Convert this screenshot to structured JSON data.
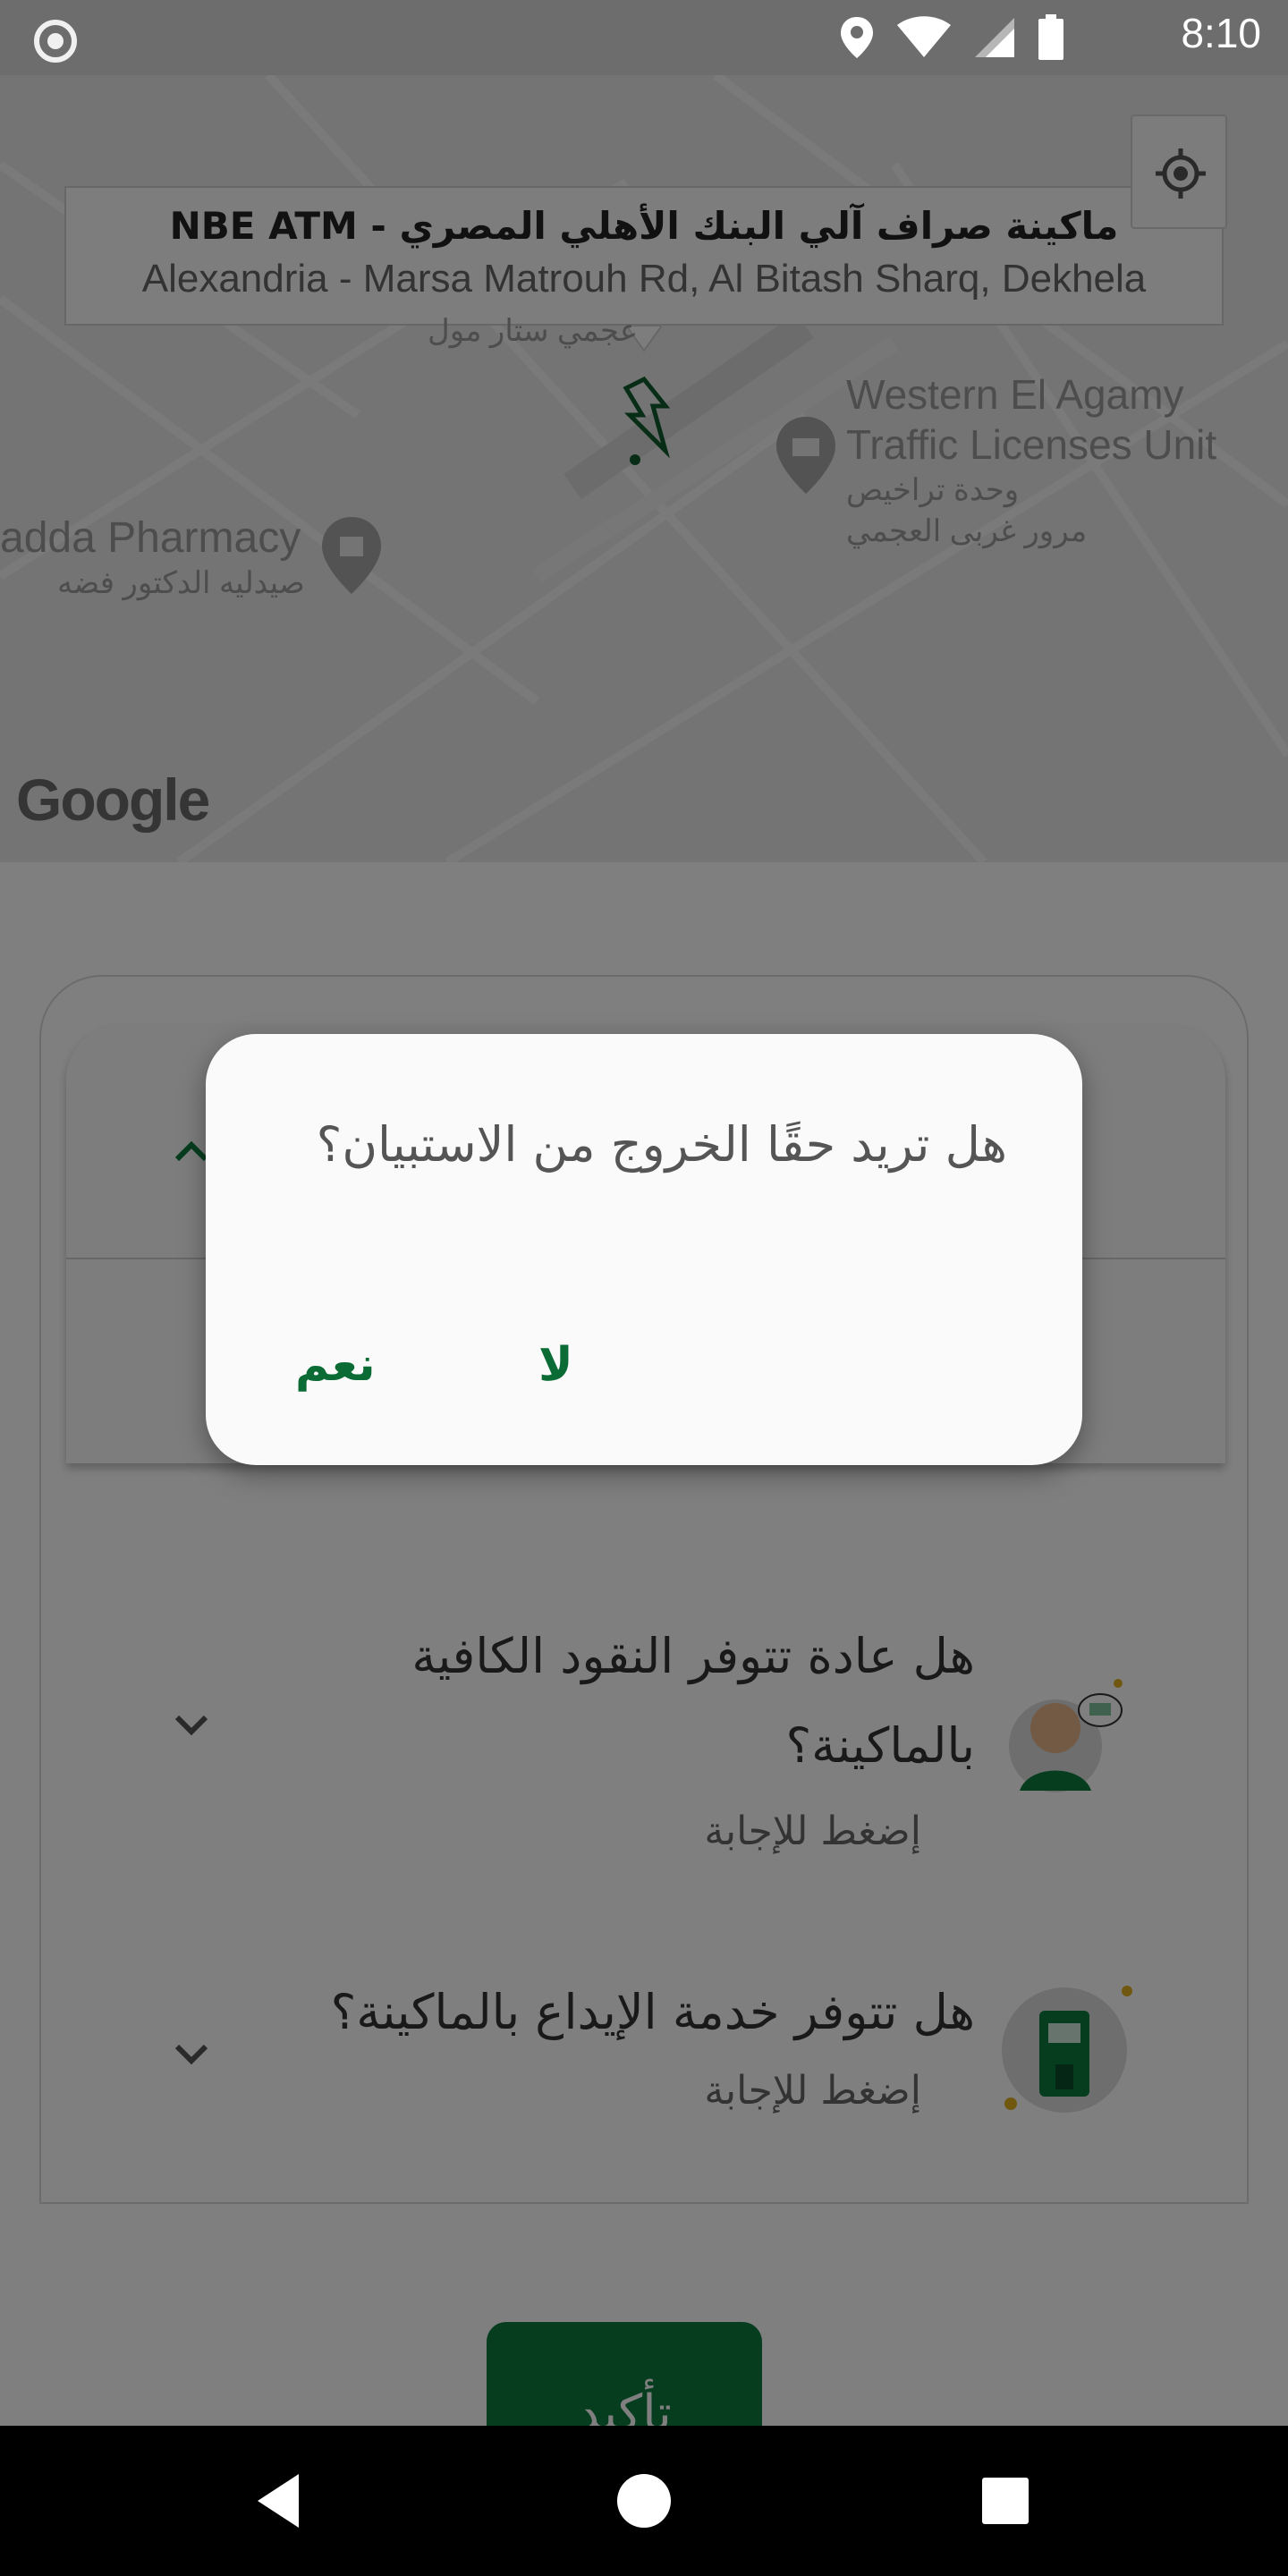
{
  "status_bar": {
    "time": "8:10",
    "icons": [
      "screen-record-icon",
      "location-icon",
      "wifi-icon",
      "signal-icon",
      "battery-icon"
    ]
  },
  "map": {
    "info_window": {
      "title": "ماكينة صراف آلي البنك الأهلي المصري - NBE ATM",
      "address": "Alexandria - Marsa Matrouh Rd, Al Bitash Sharq, Dekhela"
    },
    "labels": {
      "mall_ar": "عجمي ستار مول",
      "traffic_en_1": "Western El Agamy",
      "traffic_en_2": "Traffic Licenses Unit",
      "traffic_ar_1": "وحدة تراخيص",
      "traffic_ar_2": "مرور غربى العجمي",
      "pharmacy_en": "adda Pharmacy",
      "pharmacy_ar": "صيدليه الدكتور فضه"
    },
    "attribution": "Google"
  },
  "survey": {
    "q2": "هل عادة تتوفر النقود الكافية بالماكينة؟",
    "q2_line1": "هل عادة تتوفر النقود الكافية",
    "q2_line2": "بالماكينة؟",
    "q2_hint": "إضغط للإجابة",
    "q3": "هل تتوفر خدمة الإيداع بالماكينة؟",
    "q3_hint": "إضغط للإجابة",
    "confirm_label": "تأكيد"
  },
  "dialog": {
    "message": "هل تريد حقًا الخروج من الاستبيان؟",
    "no_label": "لا",
    "yes_label": "نعم"
  },
  "colors": {
    "primary_green": "#0e7a3f",
    "dialog_button_text": "#0a6b35"
  }
}
